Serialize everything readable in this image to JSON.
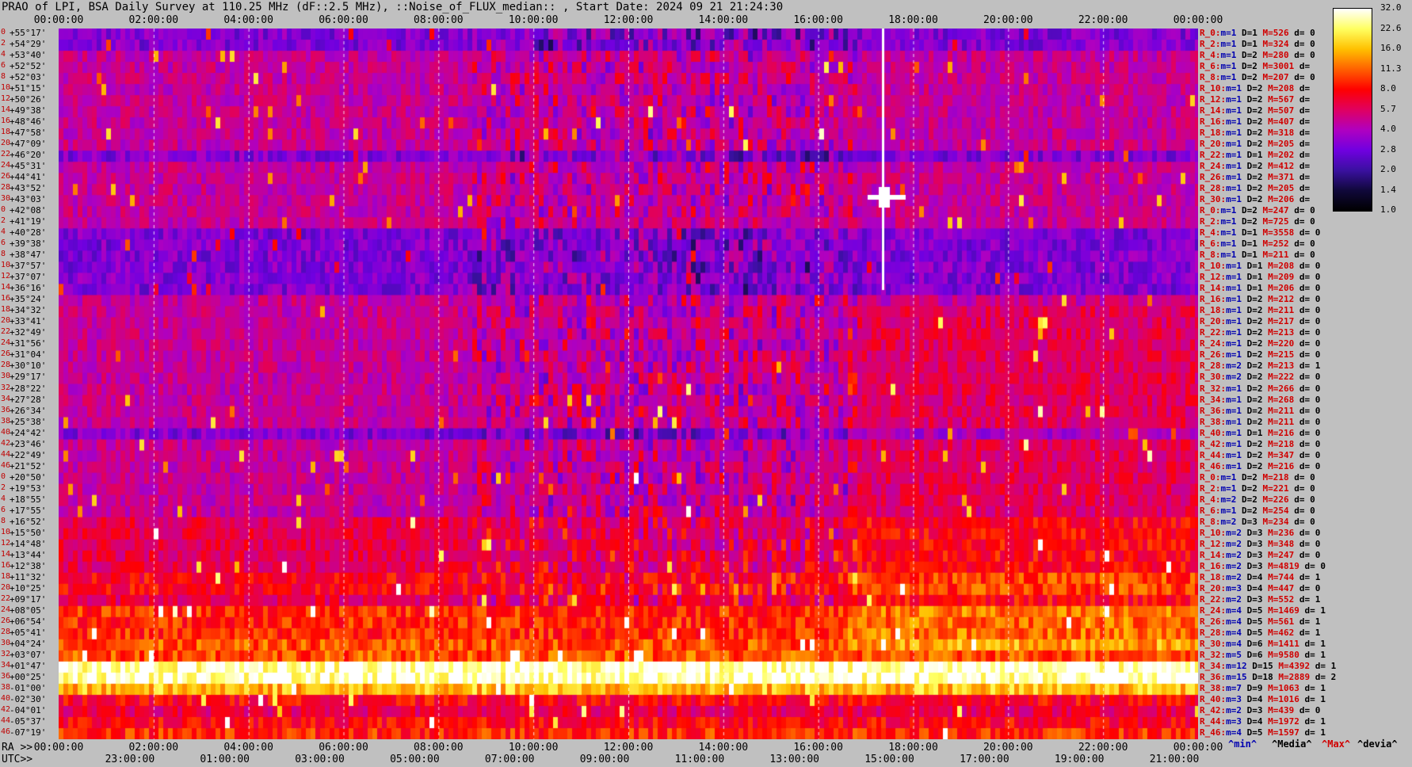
{
  "title": "PRAO of LPI, BSA Daily Survey at 110.25 MHz (dF::2.5 MHz), ::Noise_of_FLUX_median:: , Start Date: 2024 09 21 21:24:30",
  "chart_data": {
    "type": "heatmap",
    "title": "PRAO of LPI, BSA Daily Survey at 110.25 MHz (dF::2.5 MHz), ::Noise_of_FLUX_median:: , Start Date: 2024 09 21 21:24:30",
    "x_ticks_top": [
      "00:00:00",
      "02:00:00",
      "04:00:00",
      "06:00:00",
      "08:00:00",
      "10:00:00",
      "12:00:00",
      "14:00:00",
      "16:00:00",
      "18:00:00",
      "20:00:00",
      "22:00:00",
      "00:00:00"
    ],
    "x_ticks_ra": [
      "00:00:00",
      "02:00:00",
      "04:00:00",
      "06:00:00",
      "08:00:00",
      "10:00:00",
      "12:00:00",
      "14:00:00",
      "16:00:00",
      "18:00:00",
      "20:00:00",
      "22:00:00",
      "00:00:00"
    ],
    "x_ticks_utc": [
      "23:00:00",
      "01:00:00",
      "03:00:00",
      "05:00:00",
      "07:00:00",
      "09:00:00",
      "11:00:00",
      "13:00:00",
      "15:00:00",
      "17:00:00",
      "19:00:00",
      "21:00:00"
    ],
    "ra_label": "RA >>",
    "utc_label": "UTC>>",
    "declinations": [
      "+55°17'",
      "+54°29'",
      "+53°40'",
      "+52°52'",
      "+52°03'",
      "+51°15'",
      "+50°26'",
      "+49°38'",
      "+48°46'",
      "+47°58'",
      "+47°09'",
      "+46°20'",
      "+45°31'",
      "+44°41'",
      "+43°52'",
      "+43°03'",
      "+42°08'",
      "+41°19'",
      "+40°28'",
      "+39°38'",
      "+38°47'",
      "+37°57'",
      "+37°07'",
      "+36°16'",
      "+35°24'",
      "+34°32'",
      "+33°41'",
      "+32°49'",
      "+31°56'",
      "+31°04'",
      "+30°10'",
      "+29°17'",
      "+28°22'",
      "+27°28'",
      "+26°34'",
      "+25°38'",
      "+24°42'",
      "+23°46'",
      "+22°49'",
      "+21°52'",
      "+20°50'",
      "+19°53'",
      "+18°55'",
      "+17°55'",
      "+16°52'",
      "+15°50'",
      "+14°48'",
      "+13°44'",
      "+12°38'",
      "+11°32'",
      "+10°25'",
      "+09°17'",
      "+08°05'",
      "+06°54'",
      "+05°41'",
      "+04°24'",
      "+03°07'",
      "+01°47'",
      "+00°25'",
      "-01°00'",
      "-02°30'",
      "-04°01'",
      "-05°37'",
      "-07°19'"
    ],
    "row_numbers": [
      "0",
      "2",
      "4",
      "6",
      "8",
      "10",
      "12",
      "14",
      "16",
      "18",
      "20",
      "22",
      "24",
      "26",
      "28",
      "30",
      "0",
      "2",
      "4",
      "6",
      "8",
      "10",
      "12",
      "14",
      "16",
      "18",
      "20",
      "22",
      "24",
      "26",
      "28",
      "30",
      "32",
      "34",
      "36",
      "38",
      "40",
      "42",
      "44",
      "46",
      "0",
      "2",
      "4",
      "6",
      "8",
      "10",
      "12",
      "14",
      "16",
      "18",
      "20",
      "22",
      "24",
      "26",
      "28",
      "30",
      "32",
      "34",
      "36",
      "38",
      "40",
      "42",
      "44",
      "46"
    ],
    "stats": [
      {
        "r": "R_0:",
        "m": "1",
        "D": "1",
        "M": "526",
        "d": "0"
      },
      {
        "r": "R_2:",
        "m": "1",
        "D": "1",
        "M": "324",
        "d": "0"
      },
      {
        "r": "R_4:",
        "m": "1",
        "D": "2",
        "M": "280",
        "d": "0"
      },
      {
        "r": "R_6:",
        "m": "1",
        "D": "2",
        "M": "3001",
        "d": ""
      },
      {
        "r": "R_8:",
        "m": "1",
        "D": "2",
        "M": "207",
        "d": "0"
      },
      {
        "r": "R_10:",
        "m": "1",
        "D": "2",
        "M": "208",
        "d": ""
      },
      {
        "r": "R_12:",
        "m": "1",
        "D": "2",
        "M": "567",
        "d": ""
      },
      {
        "r": "R_14:",
        "m": "1",
        "D": "2",
        "M": "507",
        "d": ""
      },
      {
        "r": "R_16:",
        "m": "1",
        "D": "2",
        "M": "407",
        "d": ""
      },
      {
        "r": "R_18:",
        "m": "1",
        "D": "2",
        "M": "318",
        "d": ""
      },
      {
        "r": "R_20:",
        "m": "1",
        "D": "2",
        "M": "205",
        "d": ""
      },
      {
        "r": "R_22:",
        "m": "1",
        "D": "1",
        "M": "202",
        "d": ""
      },
      {
        "r": "R_24:",
        "m": "1",
        "D": "2",
        "M": "412",
        "d": ""
      },
      {
        "r": "R_26:",
        "m": "1",
        "D": "2",
        "M": "371",
        "d": ""
      },
      {
        "r": "R_28:",
        "m": "1",
        "D": "2",
        "M": "205",
        "d": ""
      },
      {
        "r": "R_30:",
        "m": "1",
        "D": "2",
        "M": "206",
        "d": ""
      },
      {
        "r": "R_0:",
        "m": "1",
        "D": "2",
        "M": "247",
        "d": "0"
      },
      {
        "r": "R_2:",
        "m": "1",
        "D": "2",
        "M": "725",
        "d": "0"
      },
      {
        "r": "R_4:",
        "m": "1",
        "D": "1",
        "M": "3558",
        "d": "0"
      },
      {
        "r": "R_6:",
        "m": "1",
        "D": "1",
        "M": "252",
        "d": "0"
      },
      {
        "r": "R_8:",
        "m": "1",
        "D": "1",
        "M": "211",
        "d": "0"
      },
      {
        "r": "R_10:",
        "m": "1",
        "D": "1",
        "M": "208",
        "d": "0"
      },
      {
        "r": "R_12:",
        "m": "1",
        "D": "1",
        "M": "209",
        "d": "0"
      },
      {
        "r": "R_14:",
        "m": "1",
        "D": "1",
        "M": "206",
        "d": "0"
      },
      {
        "r": "R_16:",
        "m": "1",
        "D": "2",
        "M": "212",
        "d": "0"
      },
      {
        "r": "R_18:",
        "m": "1",
        "D": "2",
        "M": "211",
        "d": "0"
      },
      {
        "r": "R_20:",
        "m": "1",
        "D": "2",
        "M": "217",
        "d": "0"
      },
      {
        "r": "R_22:",
        "m": "1",
        "D": "2",
        "M": "213",
        "d": "0"
      },
      {
        "r": "R_24:",
        "m": "1",
        "D": "2",
        "M": "220",
        "d": "0"
      },
      {
        "r": "R_26:",
        "m": "1",
        "D": "2",
        "M": "215",
        "d": "0"
      },
      {
        "r": "R_28:",
        "m": "2",
        "D": "2",
        "M": "213",
        "d": "1"
      },
      {
        "r": "R_30:",
        "m": "2",
        "D": "2",
        "M": "222",
        "d": "0"
      },
      {
        "r": "R_32:",
        "m": "1",
        "D": "2",
        "M": "266",
        "d": "0"
      },
      {
        "r": "R_34:",
        "m": "1",
        "D": "2",
        "M": "268",
        "d": "0"
      },
      {
        "r": "R_36:",
        "m": "1",
        "D": "2",
        "M": "211",
        "d": "0"
      },
      {
        "r": "R_38:",
        "m": "1",
        "D": "2",
        "M": "211",
        "d": "0"
      },
      {
        "r": "R_40:",
        "m": "1",
        "D": "1",
        "M": "216",
        "d": "0"
      },
      {
        "r": "R_42:",
        "m": "1",
        "D": "2",
        "M": "218",
        "d": "0"
      },
      {
        "r": "R_44:",
        "m": "1",
        "D": "2",
        "M": "347",
        "d": "0"
      },
      {
        "r": "R_46:",
        "m": "1",
        "D": "2",
        "M": "216",
        "d": "0"
      },
      {
        "r": "R_0:",
        "m": "1",
        "D": "2",
        "M": "218",
        "d": "0"
      },
      {
        "r": "R_2:",
        "m": "1",
        "D": "2",
        "M": "221",
        "d": "0"
      },
      {
        "r": "R_4:",
        "m": "2",
        "D": "2",
        "M": "226",
        "d": "0"
      },
      {
        "r": "R_6:",
        "m": "1",
        "D": "2",
        "M": "254",
        "d": "0"
      },
      {
        "r": "R_8:",
        "m": "2",
        "D": "3",
        "M": "234",
        "d": "0"
      },
      {
        "r": "R_10:",
        "m": "2",
        "D": "3",
        "M": "236",
        "d": "0"
      },
      {
        "r": "R_12:",
        "m": "2",
        "D": "3",
        "M": "348",
        "d": "0"
      },
      {
        "r": "R_14:",
        "m": "2",
        "D": "3",
        "M": "247",
        "d": "0"
      },
      {
        "r": "R_16:",
        "m": "2",
        "D": "3",
        "M": "4819",
        "d": "0"
      },
      {
        "r": "R_18:",
        "m": "2",
        "D": "4",
        "M": "744",
        "d": "1"
      },
      {
        "r": "R_20:",
        "m": "3",
        "D": "4",
        "M": "447",
        "d": "0"
      },
      {
        "r": "R_22:",
        "m": "2",
        "D": "3",
        "M": "552",
        "d": "1"
      },
      {
        "r": "R_24:",
        "m": "4",
        "D": "5",
        "M": "1469",
        "d": "1"
      },
      {
        "r": "R_26:",
        "m": "4",
        "D": "5",
        "M": "561",
        "d": "1"
      },
      {
        "r": "R_28:",
        "m": "4",
        "D": "5",
        "M": "462",
        "d": "1"
      },
      {
        "r": "R_30:",
        "m": "4",
        "D": "6",
        "M": "1411",
        "d": "1"
      },
      {
        "r": "R_32:",
        "m": "5",
        "D": "6",
        "M": "9580",
        "d": "1"
      },
      {
        "r": "R_34:",
        "m": "12",
        "D": "15",
        "M": "4392",
        "d": "1"
      },
      {
        "r": "R_36:",
        "m": "15",
        "D": "18",
        "M": "2889",
        "d": "2"
      },
      {
        "r": "R_38:",
        "m": "7",
        "D": "9",
        "M": "1063",
        "d": "1"
      },
      {
        "r": "R_40:",
        "m": "3",
        "D": "4",
        "M": "1016",
        "d": "1"
      },
      {
        "r": "R_42:",
        "m": "2",
        "D": "3",
        "M": "439",
        "d": "0"
      },
      {
        "r": "R_44:",
        "m": "3",
        "D": "4",
        "M": "1972",
        "d": "1"
      },
      {
        "r": "R_46:",
        "m": "4",
        "D": "5",
        "M": "1597",
        "d": "1"
      }
    ],
    "colorbar": {
      "ticks": [
        "32.0",
        "22.6",
        "16.0",
        "11.3",
        "8.0",
        "5.7",
        "4.0",
        "2.8",
        "2.0",
        "1.4",
        "1.0"
      ],
      "stops": [
        "#ffffff",
        "#ffff60",
        "#ffc000",
        "#ff6000",
        "#ff0000",
        "#e00060",
        "#b000c0",
        "#7000e0",
        "#3a10a0",
        "#10083a",
        "#000000"
      ]
    },
    "legend": {
      "min": "^min^",
      "median": "^Media^",
      "max": "^Max^",
      "devia": "^devia^"
    },
    "colors": {
      "min": "#0000b0",
      "median": "#000000",
      "max": "#d00000",
      "devia": "#000000"
    }
  }
}
